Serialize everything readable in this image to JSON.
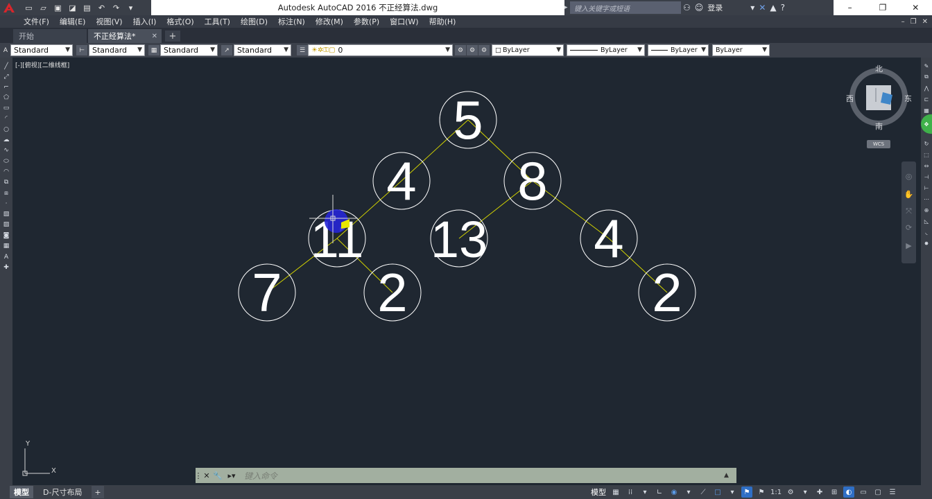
{
  "titlebar": {
    "title": "Autodesk AutoCAD 2016    不正经算法.dwg",
    "search_placeholder": "键入关键字或短语",
    "login_label": "登录",
    "icons": [
      "new-icon",
      "open-icon",
      "save-icon",
      "saveas-icon",
      "print-icon",
      "undo-icon",
      "redo-icon",
      "qat-menu-icon"
    ]
  },
  "menubar": {
    "items": [
      "文件(F)",
      "编辑(E)",
      "视图(V)",
      "插入(I)",
      "格式(O)",
      "工具(T)",
      "绘图(D)",
      "标注(N)",
      "修改(M)",
      "参数(P)",
      "窗口(W)",
      "帮助(H)"
    ]
  },
  "tabs": [
    {
      "label": "开始",
      "active": false
    },
    {
      "label": "不正经算法*",
      "active": true
    }
  ],
  "properties_toolbar": {
    "text_style": "Standard",
    "dim_style": "Standard",
    "table_style": "Standard",
    "mleader_style": "Standard",
    "layer": "0",
    "color": "ByLayer",
    "linetype": "ByLayer",
    "lineweight": "ByLayer",
    "plotstyle": "ByLayer"
  },
  "viewport": {
    "label": "[-][俯视][二维线框]",
    "background": "#1f2731",
    "circle_color": "#ffffff",
    "line_color": "#d4d400",
    "nodes": [
      {
        "id": "n5",
        "label": "5"
      },
      {
        "id": "n4a",
        "label": "4"
      },
      {
        "id": "n8",
        "label": "8"
      },
      {
        "id": "n11",
        "label": "11"
      },
      {
        "id": "n13",
        "label": "13"
      },
      {
        "id": "n4b",
        "label": "4"
      },
      {
        "id": "n7",
        "label": "7"
      },
      {
        "id": "n2a",
        "label": "2"
      },
      {
        "id": "n2b",
        "label": "2"
      }
    ],
    "edges": [
      [
        "n5",
        "n4a"
      ],
      [
        "n5",
        "n8"
      ],
      [
        "n4a",
        "n11"
      ],
      [
        "n8",
        "n13"
      ],
      [
        "n8",
        "n4b"
      ],
      [
        "n11",
        "n7"
      ],
      [
        "n11",
        "n2a"
      ],
      [
        "n4b",
        "n2b"
      ]
    ]
  },
  "viewcube": {
    "north": "北",
    "south": "南",
    "east": "东",
    "west": "西",
    "wcs": "WCS"
  },
  "ucs": {
    "x_label": "X",
    "y_label": "Y"
  },
  "command_line": {
    "placeholder": "键入命令"
  },
  "statusbar": {
    "layout_tabs": [
      "模型",
      "D-尺寸布局"
    ],
    "model_label": "模型",
    "scale": "1:1"
  }
}
